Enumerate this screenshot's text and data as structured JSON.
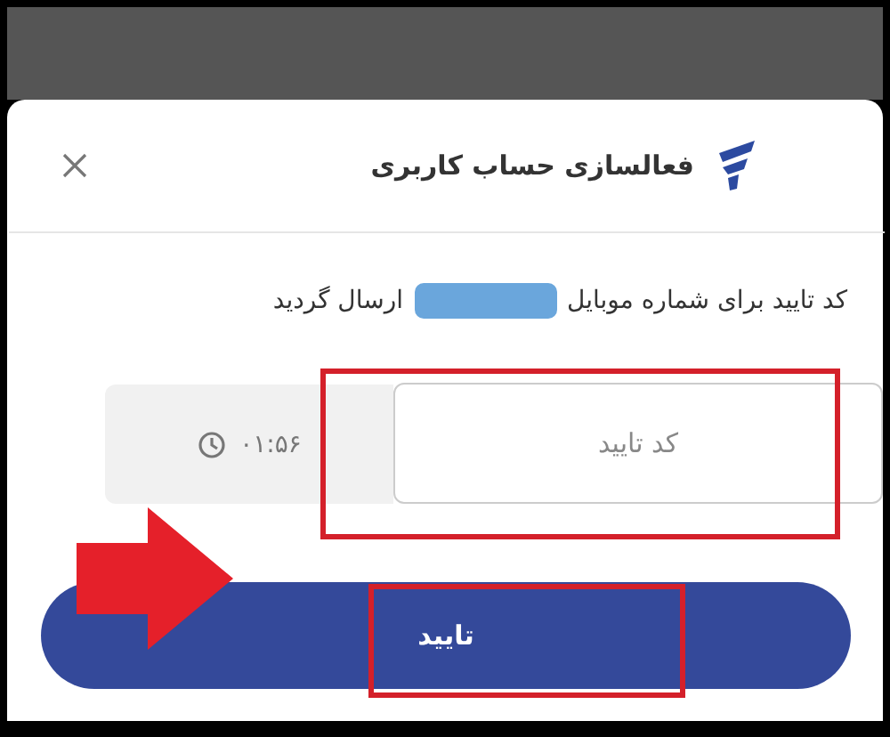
{
  "dialog": {
    "title": "فعالسازی حساب کاربری"
  },
  "message": {
    "before": "کد تایید برای شماره موبایل",
    "after": "ارسال گردید"
  },
  "code_field": {
    "placeholder": "کد تایید"
  },
  "timer": {
    "text": "۰۱:۵۶"
  },
  "submit_button": {
    "label": "تایید"
  }
}
